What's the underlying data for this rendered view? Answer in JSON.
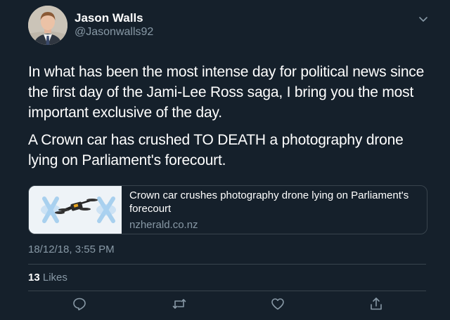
{
  "user": {
    "display_name": "Jason Walls",
    "handle": "@Jasonwalls92"
  },
  "tweet": {
    "paragraphs": [
      "In what has been the most intense day for political news since the first day of the Jami-Lee Ross saga, I bring you the most important exclusive of the day.",
      "A Crown car has crushed TO DEATH a photography drone lying on Parliament's forecourt."
    ],
    "timestamp": "18/12/18, 3:55 PM"
  },
  "link_card": {
    "title": "Crown car crushes photography drone lying on Parliament's forecourt",
    "domain": "nzherald.co.nz"
  },
  "stats": {
    "likes_count": "13",
    "likes_label": "Likes"
  },
  "actions": [
    "reply-icon",
    "retweet-icon",
    "like-icon",
    "share-icon"
  ],
  "colors": {
    "background": "#15202b",
    "secondary_text": "#8899a6",
    "border": "#38444d"
  }
}
